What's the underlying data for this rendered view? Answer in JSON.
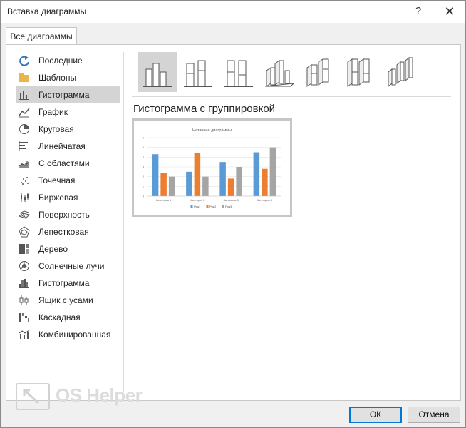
{
  "window": {
    "title": "Вставка диаграммы",
    "help_glyph": "?",
    "close_glyph": "✕"
  },
  "tab": {
    "label": "Все диаграммы"
  },
  "sidebar": {
    "items": [
      {
        "label": "Последние",
        "icon": "recent-icon"
      },
      {
        "label": "Шаблоны",
        "icon": "folder-icon"
      },
      {
        "label": "Гистограмма",
        "icon": "column-chart-icon",
        "selected": true
      },
      {
        "label": "График",
        "icon": "line-chart-icon"
      },
      {
        "label": "Круговая",
        "icon": "pie-chart-icon"
      },
      {
        "label": "Линейчатая",
        "icon": "bar-chart-icon"
      },
      {
        "label": "С областями",
        "icon": "area-chart-icon"
      },
      {
        "label": "Точечная",
        "icon": "scatter-chart-icon"
      },
      {
        "label": "Биржевая",
        "icon": "stock-chart-icon"
      },
      {
        "label": "Поверхность",
        "icon": "surface-chart-icon"
      },
      {
        "label": "Лепестковая",
        "icon": "radar-chart-icon"
      },
      {
        "label": "Дерево",
        "icon": "treemap-chart-icon"
      },
      {
        "label": "Солнечные лучи",
        "icon": "sunburst-chart-icon"
      },
      {
        "label": "Гистограмма",
        "icon": "histogram-chart-icon"
      },
      {
        "label": "Ящик с усами",
        "icon": "box-whisker-chart-icon"
      },
      {
        "label": "Каскадная",
        "icon": "waterfall-chart-icon"
      },
      {
        "label": "Комбинированная",
        "icon": "combo-chart-icon"
      }
    ]
  },
  "main": {
    "subtype_icons": [
      "clustered-column-icon",
      "stacked-column-icon",
      "stacked-100-column-icon",
      "3d-clustered-column-icon",
      "3d-stacked-column-icon",
      "3d-stacked-100-column-icon",
      "3d-column-icon"
    ],
    "selected_subtype": 0,
    "preview_title": "Гистограмма с группировкой"
  },
  "chart_data": {
    "type": "bar",
    "title": "Название диаграммы",
    "categories": [
      "Категория 1",
      "Категория 2",
      "Категория 3",
      "Категория 4"
    ],
    "series": [
      {
        "name": "Ряд1",
        "values": [
          4.3,
          2.5,
          3.5,
          4.5
        ],
        "color": "#5b9bd5"
      },
      {
        "name": "Ряд2",
        "values": [
          2.4,
          4.4,
          1.8,
          2.8
        ],
        "color": "#ed7d31"
      },
      {
        "name": "Ряд3",
        "values": [
          2.0,
          2.0,
          3.0,
          5.0
        ],
        "color": "#a5a5a5"
      }
    ],
    "y_ticks": [
      "0",
      "1",
      "2",
      "3",
      "4",
      "5",
      "6"
    ],
    "ylim": [
      0,
      6
    ],
    "grid": true,
    "legend": "bottom"
  },
  "watermark": {
    "text": "OS Helper"
  },
  "buttons": {
    "ok": "ОК",
    "cancel": "Отмена"
  },
  "colors": {
    "accent": "#0078d7",
    "selection": "#d4d4d4"
  }
}
